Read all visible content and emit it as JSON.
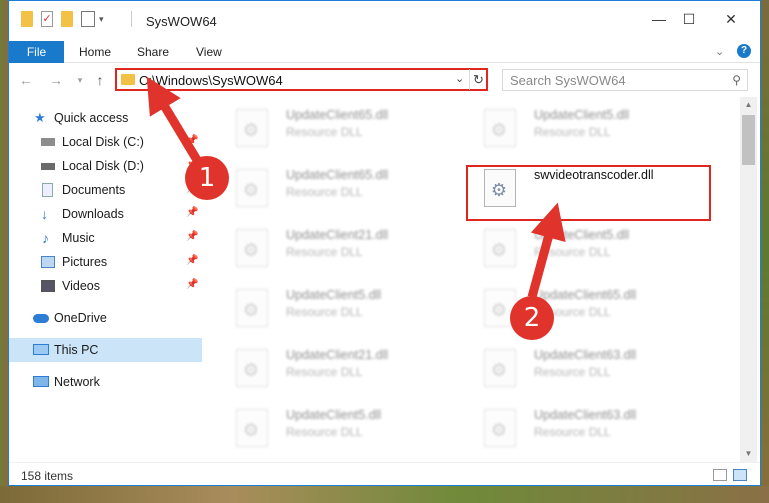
{
  "window": {
    "title": "SysWOW64",
    "controls": {
      "minimize": "—",
      "maximize": "☐",
      "close": "✕"
    }
  },
  "ribbon": {
    "tabs": [
      {
        "label": "File"
      },
      {
        "label": "Home"
      },
      {
        "label": "Share"
      },
      {
        "label": "View"
      }
    ]
  },
  "address": {
    "path": "C:\\Windows\\SysWOW64",
    "search_placeholder": "Search SysWOW64"
  },
  "nav": {
    "items": [
      {
        "label": "Quick access",
        "icon": "star-icon"
      },
      {
        "label": "Local Disk (C:)",
        "icon": "drive-icon"
      },
      {
        "label": "Local Disk (D:)",
        "icon": "drive-icon"
      },
      {
        "label": "Documents",
        "icon": "documents-icon"
      },
      {
        "label": "Downloads",
        "icon": "download-icon"
      },
      {
        "label": "Music",
        "icon": "music-icon"
      },
      {
        "label": "Pictures",
        "icon": "pictures-icon"
      },
      {
        "label": "Videos",
        "icon": "videos-icon"
      },
      {
        "label": "OneDrive",
        "icon": "cloud-icon"
      },
      {
        "label": "This PC",
        "icon": "computer-icon"
      },
      {
        "label": "Network",
        "icon": "network-icon"
      }
    ]
  },
  "files": [
    {
      "name": "UpdateClient65.dll",
      "type": "Resource DLL"
    },
    {
      "name": "UpdateClient5.dll",
      "type": "Resource DLL"
    },
    {
      "name": "UpdateClient65.dll",
      "type": "Resource DLL"
    },
    {
      "name": "swvideotranscoder.dll",
      "type": ""
    },
    {
      "name": "UpdateClient21.dll",
      "type": "Resource DLL"
    },
    {
      "name": "UpdateClient5.dll",
      "type": "Resource DLL"
    },
    {
      "name": "UpdateClient5.dll",
      "type": "Resource DLL"
    },
    {
      "name": "UpdateClient65.dll",
      "type": "Resource DLL"
    },
    {
      "name": "UpdateClient21.dll",
      "type": "Resource DLL"
    },
    {
      "name": "UpdateClient63.dll",
      "type": "Resource DLL"
    },
    {
      "name": "UpdateClient5.dll",
      "type": "Resource DLL"
    },
    {
      "name": "UpdateClient63.dll",
      "type": "Resource DLL"
    }
  ],
  "status": {
    "item_count": "158 items"
  },
  "annotations": {
    "step1": "1",
    "step2": "2",
    "color": "#e0271f"
  }
}
